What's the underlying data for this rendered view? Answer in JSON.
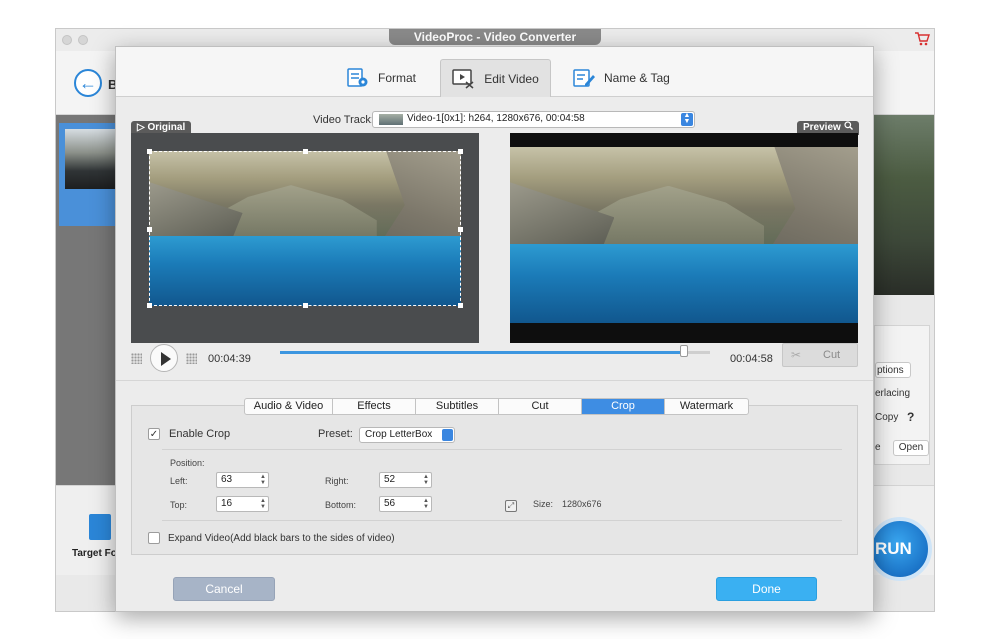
{
  "background_window": {
    "title": "VideoProc - Video Converter",
    "back_label": "B",
    "target_label": "Target Fo",
    "right_panel": {
      "options_label": "ptions",
      "interlacing_label": "erlacing",
      "copy_label": "Copy",
      "help_label": "?",
      "e_label": "e",
      "open_label": "Open"
    },
    "run_label": "RUN"
  },
  "dialog": {
    "top_tabs": [
      {
        "label": "Format",
        "icon": "format-icon"
      },
      {
        "label": "Edit Video",
        "icon": "edit-video-icon"
      },
      {
        "label": "Name & Tag",
        "icon": "name-tag-icon"
      }
    ],
    "active_top_tab": "Edit Video",
    "video_track": {
      "label": "Video Track:",
      "value": "Video-1[0x1]: h264, 1280x676, 00:04:58"
    },
    "original_tag": "▷ Original",
    "preview_tag": "Preview",
    "playback": {
      "current_time": "00:04:39",
      "total_time": "00:04:58",
      "progress": 0.94,
      "cut_label": "Cut"
    },
    "sub_tabs": [
      "Audio & Video",
      "Effects",
      "Subtitles",
      "Cut",
      "Crop",
      "Watermark"
    ],
    "active_sub_tab": "Crop",
    "crop": {
      "enable_label": "Enable Crop",
      "enabled": true,
      "preset_label": "Preset:",
      "preset_value": "Crop LetterBox",
      "position_label": "Position:",
      "left_label": "Left:",
      "left_value": "63",
      "right_label": "Right:",
      "right_value": "52",
      "top_label": "Top:",
      "top_value": "16",
      "bottom_label": "Bottom:",
      "bottom_value": "56",
      "size_label": "Size:",
      "size_value": "1280x676",
      "expand_label": "Expand Video(Add black bars to the sides of video)",
      "expand_checked": false
    },
    "cancel_label": "Cancel",
    "done_label": "Done"
  },
  "colors": {
    "accent_blue": "#3e8de3",
    "done_blue": "#3ab0f2",
    "cancel_grey": "#a7b4c7"
  }
}
